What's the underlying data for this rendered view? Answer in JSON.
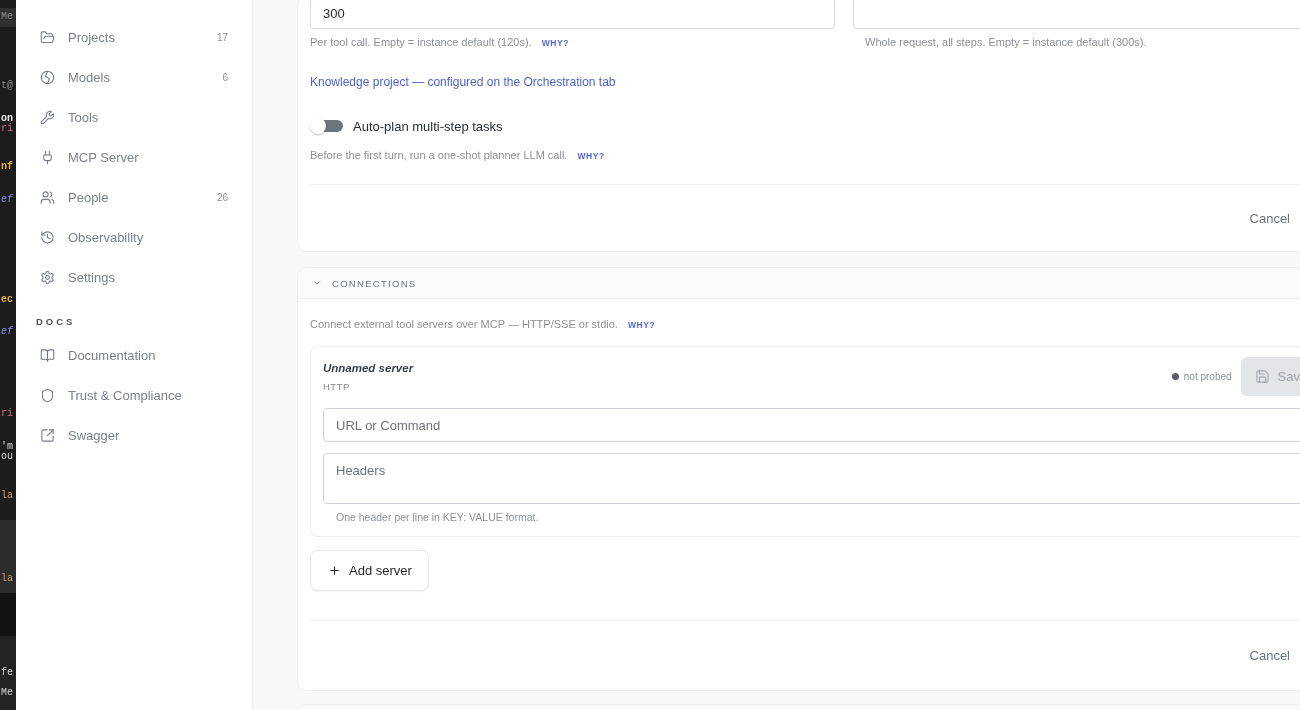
{
  "background_editor": {
    "lines": [
      {
        "text": "Me",
        "kind": "ui"
      },
      {
        "text": "t@",
        "kind": "dim"
      },
      {
        "text": "on",
        "kind": "name"
      },
      {
        "text": "ri",
        "kind": "string"
      },
      {
        "text": "nf",
        "kind": "keyword"
      },
      {
        "text": "ef",
        "kind": "param"
      },
      {
        "text": "ec",
        "kind": "keyword"
      },
      {
        "text": "ef",
        "kind": "param"
      },
      {
        "text": "ri",
        "kind": "string"
      },
      {
        "text": "'m",
        "kind": "text"
      },
      {
        "text": "ou",
        "kind": "text"
      },
      {
        "text": "la",
        "kind": "attr"
      },
      {
        "text": "la",
        "kind": "attr"
      },
      {
        "text": "fe",
        "kind": "text"
      },
      {
        "text": "Me",
        "kind": "text"
      }
    ]
  },
  "sidebar": {
    "nav": [
      {
        "label": "Projects",
        "count": "17",
        "selected": false
      },
      {
        "label": "Models",
        "count": "6",
        "selected": false
      },
      {
        "label": "Tools",
        "selected": false
      },
      {
        "label": "MCP Server",
        "selected": false
      },
      {
        "label": "People",
        "count": "26",
        "selected": false
      },
      {
        "label": "Observability",
        "selected": false
      },
      {
        "label": "Settings",
        "selected": false
      }
    ],
    "docs": {
      "heading": "DOCS",
      "items": [
        {
          "label": "Documentation",
          "selected": false
        },
        {
          "label": "Trust & Compliance",
          "selected": false
        },
        {
          "label": "Swagger",
          "selected": false
        }
      ]
    }
  },
  "timeouts": {
    "fields": [
      {
        "value": "300",
        "hint": "Per tool call. Empty = instance default (120s).",
        "link": "WHY?"
      },
      {
        "hint": "Whole request, all steps. Empty = instance default (300s)."
      }
    ],
    "knowledge_link": "Knowledge project — configured on the Orchestration tab",
    "toggle": {
      "label": "Auto-plan multi-step tasks",
      "on": false,
      "hint": "Before the first turn, run a one-shot planner LLM call.",
      "link": "WHY?"
    },
    "cancel": "Cancel"
  },
  "connections": {
    "title": "CONNECTIONS",
    "expanded": true,
    "description": "Connect external tool servers over MCP — HTTP/SSE or stdio.",
    "link": "WHY?",
    "servers": [
      {
        "name": "Unnamed server",
        "transport": "HTTP",
        "status": "not probed",
        "save": {
          "label": "Sav",
          "disabled": true
        },
        "url_placeholder": "URL or Command",
        "headers_placeholder": "Headers",
        "headers_hint": "One header per line in KEY: VALUE format."
      }
    ],
    "add_button": "Add server",
    "cancel": "Cancel"
  }
}
